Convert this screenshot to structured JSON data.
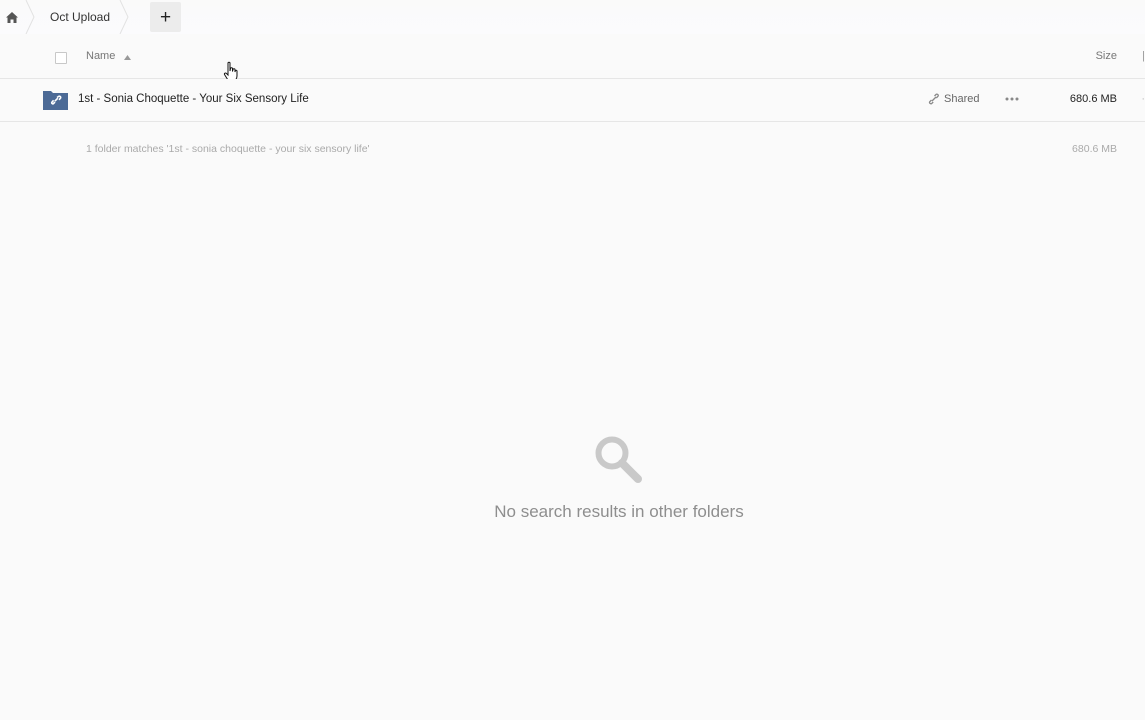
{
  "breadcrumb": {
    "home_icon": "home-icon",
    "folder": "Oct Upload",
    "add_label": "+"
  },
  "list_header": {
    "name_label": "Name",
    "size_label": "Size"
  },
  "files": [
    {
      "icon": "shared-folder-icon",
      "name": "1st - Sonia Choquette - Your Six Sensory Life",
      "share_label": "Shared",
      "size": "680.6 MB"
    }
  ],
  "summary": {
    "text": "1 folder matches '1st - sonia choquette - your six sensory life'",
    "size": "680.6 MB"
  },
  "empty_state": {
    "icon": "search-icon",
    "message": "No search results in other folders"
  },
  "colors": {
    "folder_blue": "#4c6a96",
    "background": "#fafafa"
  }
}
